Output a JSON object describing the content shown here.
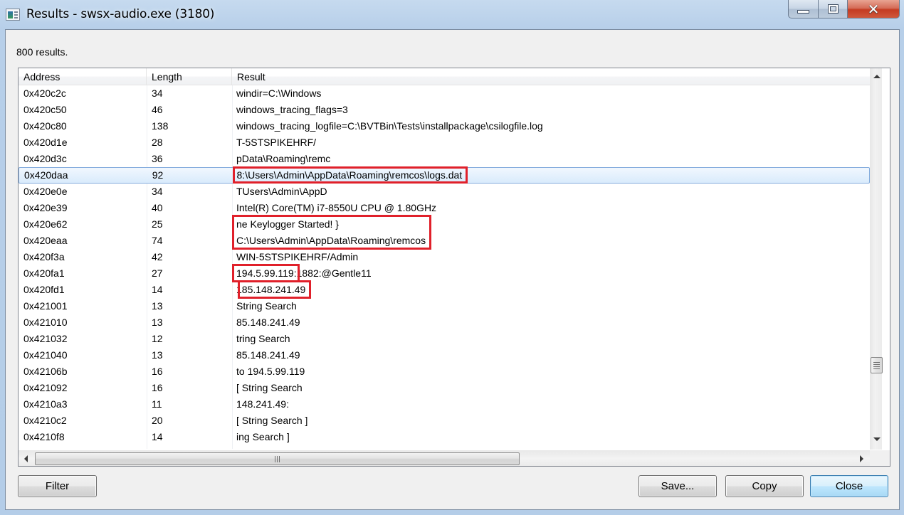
{
  "window": {
    "title": "Results - swsx-audio.exe (3180)",
    "caption_buttons": {
      "minimize": "minimize-icon",
      "maximize": "maximize-icon",
      "close": "close-icon"
    }
  },
  "summary": {
    "count_label": "800 results."
  },
  "table": {
    "columns": [
      "Address",
      "Length",
      "Result"
    ],
    "selected_index": 5,
    "rows": [
      {
        "address": "0x420c2c",
        "length": "34",
        "result": "windir=C:\\Windows"
      },
      {
        "address": "0x420c50",
        "length": "46",
        "result": "windows_tracing_flags=3"
      },
      {
        "address": "0x420c80",
        "length": "138",
        "result": "windows_tracing_logfile=C:\\BVTBin\\Tests\\installpackage\\csilogfile.log"
      },
      {
        "address": "0x420d1e",
        "length": "28",
        "result": "T-5STSPIKEHRF/"
      },
      {
        "address": "0x420d3c",
        "length": "36",
        "result": "pData\\Roaming\\remc"
      },
      {
        "address": "0x420daa",
        "length": "92",
        "result": "8:\\Users\\Admin\\AppData\\Roaming\\remcos\\logs.dat"
      },
      {
        "address": "0x420e0e",
        "length": "34",
        "result": "TUsers\\Admin\\AppD"
      },
      {
        "address": "0x420e39",
        "length": "40",
        "result": "Intel(R) Core(TM) i7-8550U CPU @ 1.80GHz"
      },
      {
        "address": "0x420e62",
        "length": "25",
        "result": "ne Keylogger Started! }"
      },
      {
        "address": "0x420eaa",
        "length": "74",
        "result": "C:\\Users\\Admin\\AppData\\Roaming\\remcos"
      },
      {
        "address": "0x420f3a",
        "length": "42",
        "result": "WIN-5STSPIKEHRF/Admin"
      },
      {
        "address": "0x420fa1",
        "length": "27",
        "result": "194.5.99.119:1882:@Gentle11"
      },
      {
        "address": "0x420fd1",
        "length": "14",
        "result": "185.148.241.49"
      },
      {
        "address": "0x421001",
        "length": "13",
        "result": "String Search"
      },
      {
        "address": "0x421010",
        "length": "13",
        "result": "85.148.241.49"
      },
      {
        "address": "0x421032",
        "length": "12",
        "result": "tring Search"
      },
      {
        "address": "0x421040",
        "length": "13",
        "result": "85.148.241.49"
      },
      {
        "address": "0x42106b",
        "length": "16",
        "result": " to 194.5.99.119"
      },
      {
        "address": "0x421092",
        "length": "16",
        "result": "[ String Search"
      },
      {
        "address": "0x4210a3",
        "length": "11",
        "result": "148.241.49:"
      },
      {
        "address": "0x4210c2",
        "length": "20",
        "result": "[ String Search ]"
      },
      {
        "address": "0x4210f8",
        "length": "14",
        "result": "ing Search ]"
      }
    ]
  },
  "annotations": {
    "color": "#e0202a",
    "highlighted_results": [
      "8:\\Users\\Admin\\AppData\\Roaming\\remcos\\logs.dat",
      "ne Keylogger Started! }",
      "C:\\Users\\Admin\\AppData\\Roaming\\remcos",
      "85.148.241.49",
      "194.5.99.119"
    ]
  },
  "scrollbars": {
    "vertical_position_fraction": 0.79,
    "horizontal_visible_fraction": 0.59
  },
  "buttons": {
    "filter": "Filter",
    "save": "Save...",
    "copy": "Copy",
    "close": "Close"
  },
  "colors": {
    "selection_border": "#84acdd",
    "selection_fill": "#d9ebfc",
    "default_button_border": "#3c7fb1",
    "titlebar": "#b9d1ea",
    "close_caption": "#c43b22"
  }
}
